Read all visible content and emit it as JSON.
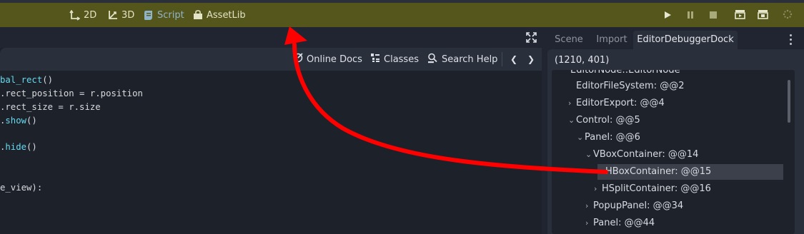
{
  "topbar": {
    "workspaces": [
      {
        "label": "2D",
        "icon": "2d-icon",
        "active": false
      },
      {
        "label": "3D",
        "icon": "3d-icon",
        "active": false
      },
      {
        "label": "Script",
        "icon": "script-icon",
        "active": true
      },
      {
        "label": "AssetLib",
        "icon": "assetlib-icon",
        "active": false
      }
    ],
    "play_controls": [
      "play-icon",
      "pause-icon",
      "stop-icon",
      "play-scene-icon",
      "play-custom-scene-icon",
      "loading-icon"
    ]
  },
  "editor": {
    "toolbar": {
      "online_docs": "Online Docs",
      "classes": "Classes",
      "search_help": "Search Help",
      "prev": "❮",
      "next": "❯"
    },
    "code_lines": [
      {
        "pre": "bal_rect",
        "fn": "",
        "post": "()"
      },
      {
        "pre": ".rect_position = r.position",
        "fn": "",
        "post": ""
      },
      {
        "pre": ".rect_size = r.size",
        "fn": "",
        "post": ""
      },
      {
        "pre": ".",
        "fn": "show",
        "post": "()"
      },
      {
        "pre": "",
        "fn": "",
        "post": ""
      },
      {
        "pre": ".",
        "fn": "hide",
        "post": "()"
      },
      {
        "pre": "",
        "fn": "",
        "post": ""
      },
      {
        "pre": "",
        "fn": "",
        "post": ""
      },
      {
        "pre": "e_view):",
        "fn": "",
        "post": ""
      }
    ]
  },
  "dock": {
    "tabs": [
      {
        "label": "Scene",
        "active": false
      },
      {
        "label": "Import",
        "active": false
      },
      {
        "label": "EditorDebuggerDock",
        "active": true
      }
    ],
    "coords": "(1210, 401)",
    "tree": [
      {
        "label": "EditorNode::EditorNode",
        "arrow": "",
        "selected": false
      },
      {
        "label": "EditorFileSystem: @@2",
        "arrow": "",
        "selected": false
      },
      {
        "label": "EditorExport: @@4",
        "arrow": ">",
        "selected": false
      },
      {
        "label": "Control: @@5",
        "arrow": "v",
        "selected": false
      },
      {
        "label": "Panel: @@6",
        "arrow": "v",
        "selected": false
      },
      {
        "label": "VBoxContainer: @@14",
        "arrow": "v",
        "selected": false
      },
      {
        "label": "HBoxContainer: @@15",
        "arrow": ">",
        "selected": true
      },
      {
        "label": "HSplitContainer: @@16",
        "arrow": ">",
        "selected": false
      },
      {
        "label": "PopupPanel: @@34",
        "arrow": ">",
        "selected": false
      },
      {
        "label": "Panel: @@44",
        "arrow": ">",
        "selected": false
      }
    ]
  },
  "colors": {
    "topbar_bg": "#55561c",
    "annotation_arrow": "#ff0000",
    "code_function": "#66d9ef"
  }
}
